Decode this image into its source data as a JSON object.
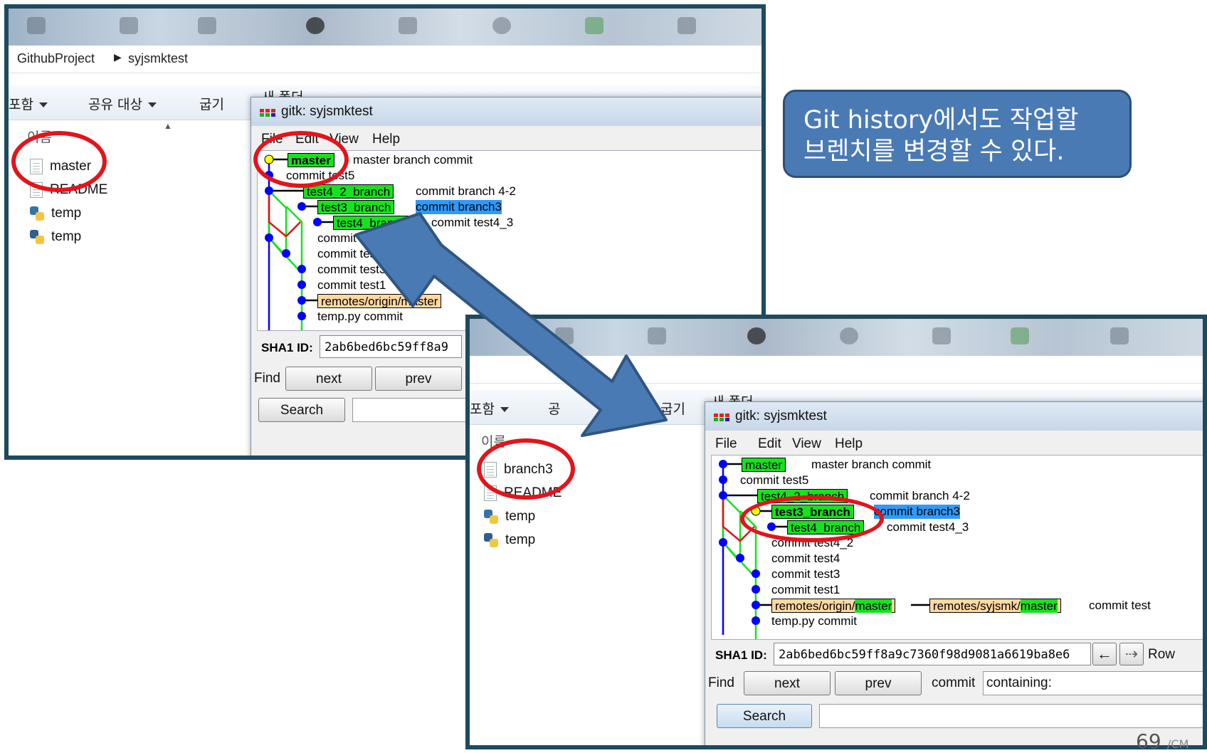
{
  "callout": {
    "text": "Git history에서도 작업할\n브렌치를 변경할 수 있다."
  },
  "before": {
    "explorer": {
      "breadcrumb": [
        "GithubProject",
        "syjsmktest"
      ],
      "toolbar": [
        "포함",
        "공유 대상",
        "굽기",
        "새 폴더"
      ],
      "column_header": "이름",
      "files": [
        {
          "name": "master",
          "icon": "text-file-icon"
        },
        {
          "name": "README",
          "icon": "text-file-icon"
        },
        {
          "name": "temp",
          "icon": "python-file-icon"
        },
        {
          "name": "temp",
          "icon": "python-file-icon"
        }
      ]
    },
    "gitk": {
      "title": "gitk: syjsmktest",
      "menu": [
        "File",
        "Edit",
        "View",
        "Help"
      ],
      "commits": [
        {
          "refs": [
            {
              "label": "master",
              "style": "green-bold"
            }
          ],
          "message": "master branch commit"
        },
        {
          "refs": [],
          "message": "commit test5"
        },
        {
          "refs": [
            {
              "label": "test4_2_branch",
              "style": "green"
            }
          ],
          "message": "commit branch 4-2"
        },
        {
          "refs": [
            {
              "label": "test3_branch",
              "style": "green"
            }
          ],
          "message": "commit branch3",
          "highlight": true
        },
        {
          "refs": [
            {
              "label": "test4_branch",
              "style": "green"
            }
          ],
          "message": "commit test4_3"
        },
        {
          "refs": [],
          "message": "commit test4_2"
        },
        {
          "refs": [],
          "message": "commit test4"
        },
        {
          "refs": [],
          "message": "commit test3"
        },
        {
          "refs": [],
          "message": "commit test1"
        },
        {
          "refs": [
            {
              "label": "remotes/origin/master",
              "style": "orange"
            }
          ],
          "message": ""
        },
        {
          "refs": [],
          "message": "temp.py commit"
        }
      ],
      "sha1_label": "SHA1 ID:",
      "sha1_value": "2ab6bed6bc59ff8a9",
      "find_label": "Find",
      "next_label": "next",
      "prev_label": "prev",
      "search_label": "Search"
    }
  },
  "after": {
    "explorer": {
      "toolbar": [
        "포함",
        "공",
        "굽기",
        "새 폴더"
      ],
      "column_header": "이름",
      "files": [
        {
          "name": "branch3",
          "icon": "text-file-icon"
        },
        {
          "name": "README",
          "icon": "text-file-icon"
        },
        {
          "name": "temp",
          "icon": "python-file-icon"
        },
        {
          "name": "temp",
          "icon": "python-file-icon"
        }
      ]
    },
    "gitk": {
      "title": "gitk: syjsmktest",
      "menu": [
        "File",
        "Edit",
        "View",
        "Help"
      ],
      "commits": [
        {
          "refs": [
            {
              "label": "master",
              "style": "green"
            }
          ],
          "message": "master branch commit"
        },
        {
          "refs": [],
          "message": "commit test5"
        },
        {
          "refs": [
            {
              "label": "test4_2_branch",
              "style": "green"
            }
          ],
          "message": "commit branch 4-2"
        },
        {
          "refs": [
            {
              "label": "test3_branch",
              "style": "green-bold"
            }
          ],
          "message": "commit branch3",
          "highlight": true
        },
        {
          "refs": [
            {
              "label": "test4_branch",
              "style": "green"
            }
          ],
          "message": "commit test4_3"
        },
        {
          "refs": [],
          "message": "commit test4_2"
        },
        {
          "refs": [],
          "message": "commit test4"
        },
        {
          "refs": [],
          "message": "commit test3"
        },
        {
          "refs": [],
          "message": "commit test1"
        },
        {
          "refs": [
            {
              "label_prefix": "remotes/origin/",
              "label_suffix": "master",
              "style": "orange"
            },
            {
              "label_prefix": "remotes/syjsmk/",
              "label_suffix": "master",
              "style": "orange"
            }
          ],
          "message": "commit test"
        },
        {
          "refs": [],
          "message": "temp.py commit"
        }
      ],
      "sha1_label": "SHA1 ID:",
      "sha1_value": "2ab6bed6bc59ff8a9c7360f98d9081a6619ba8e6",
      "row_label": "Row",
      "find_label": "Find",
      "next_label": "next",
      "prev_label": "prev",
      "commit_label": "commit",
      "containing_value": "containing:",
      "search_label": "Search"
    }
  },
  "page_number": "69",
  "page_suffix": "/CM"
}
